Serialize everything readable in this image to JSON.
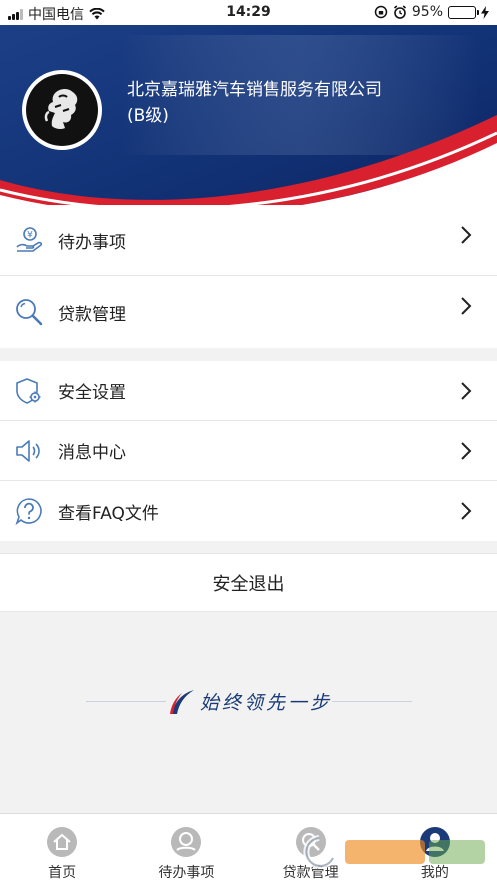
{
  "status_bar": {
    "carrier": "中国电信",
    "time": "14:29",
    "battery": "95%",
    "battery_level": 0.95
  },
  "header": {
    "company_name": "北京嘉瑞雅汽车销售服务有限公司",
    "level": "(B级)"
  },
  "menu_group_1": [
    {
      "label": "待办事项",
      "icon": "hand-coin-icon"
    },
    {
      "label": "贷款管理",
      "icon": "search-icon"
    }
  ],
  "menu_group_2": [
    {
      "label": "安全设置",
      "icon": "shield-gear-icon"
    },
    {
      "label": "消息中心",
      "icon": "speaker-icon"
    },
    {
      "label": "查看FAQ文件",
      "icon": "question-bubble-icon"
    }
  ],
  "logout_label": "安全退出",
  "slogan": "始终领先一步",
  "tabbar": [
    {
      "label": "首页",
      "icon": "home-icon"
    },
    {
      "label": "待办事项",
      "icon": "todo-icon"
    },
    {
      "label": "贷款管理",
      "icon": "loan-icon"
    },
    {
      "label": "我的",
      "icon": "user-icon",
      "active": true
    }
  ],
  "colors": {
    "brand_blue": "#1a3b78",
    "brand_red": "#d9202e",
    "icon_blue": "#4a7bb8"
  }
}
